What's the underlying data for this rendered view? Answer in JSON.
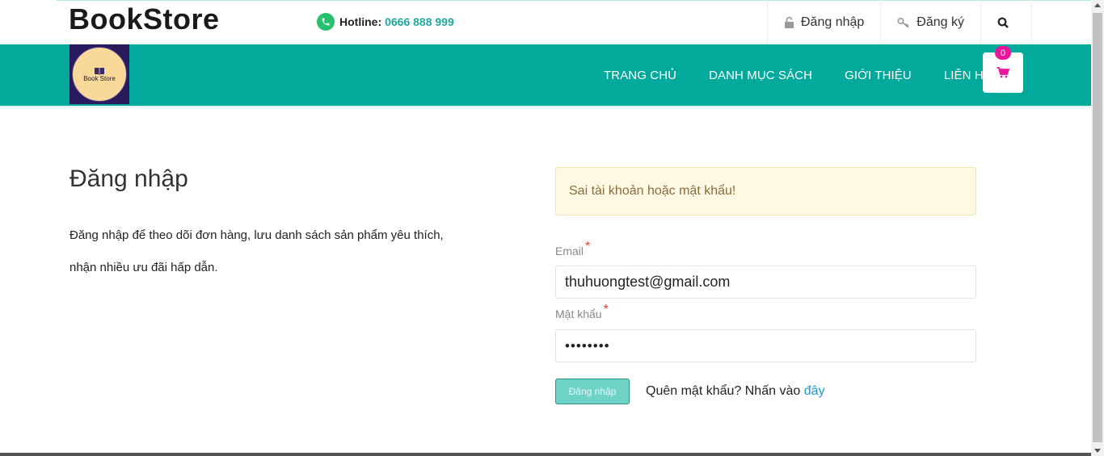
{
  "header": {
    "brand": "BookStore",
    "hotline_label": "Hotline:",
    "hotline_number": "0666 888 999",
    "login_label": "Đăng nhập",
    "register_label": "Đăng ký",
    "search_icon": "search-icon"
  },
  "navbar": {
    "logo_text": "Book Store",
    "items": [
      {
        "label": "TRANG CHỦ"
      },
      {
        "label": "DANH MỤC SÁCH"
      },
      {
        "label": "GIỚI THIỆU"
      },
      {
        "label": "LIÊN HỆ"
      }
    ],
    "cart_count": "0"
  },
  "intro": {
    "title": "Đăng nhập",
    "line1": "Đăng nhập để theo dõi đơn hàng, lưu danh sách sản phẩm yêu thích,",
    "line2": "nhận nhiều ưu đãi hấp dẫn."
  },
  "form": {
    "alert": "Sai tài khoản hoặc mật khẩu!",
    "email_label": "Email",
    "email_value": "thuhuongtest@gmail.com",
    "password_label": "Mật khẩu",
    "password_value": "••••••••",
    "required_mark": "*",
    "submit_label": "Đăng nhập",
    "forgot_text": "Quên mật khẩu? Nhấn vào",
    "forgot_link": "đây"
  },
  "colors": {
    "primary": "#03a99b",
    "cart_badge": "#e8179b",
    "link": "#1e98d4",
    "alert_bg": "#fff8e2"
  }
}
